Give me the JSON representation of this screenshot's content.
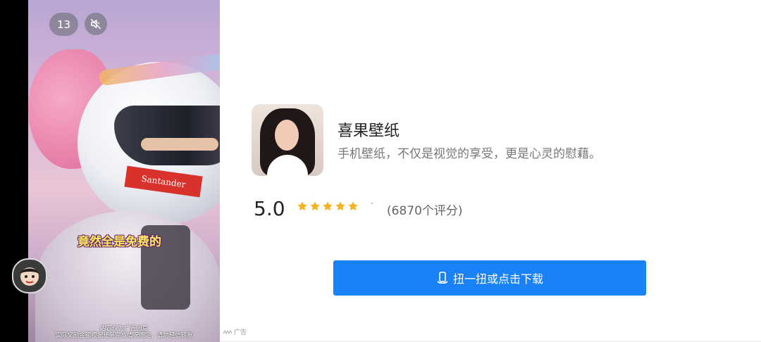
{
  "video": {
    "countdown": "13",
    "caption": "竟然全是免费的",
    "helmet_logo": "Santander",
    "disclaimer_line1": "内容仅为广告创意",
    "disclaimer_line2": "实际奖励金额根据任务完成情况而定，请勿轻信转账"
  },
  "ad": {
    "tag": "广告"
  },
  "app": {
    "name": "喜果壁纸",
    "description": "手机壁纸，不仅是视觉的享受，更是心灵的慰藉。",
    "rating": "5.0",
    "stars": 5,
    "rating_count": "(6870个评分)"
  },
  "download": {
    "label": "扭一扭或点击下载"
  },
  "colors": {
    "button": "#1a82f7",
    "star": "#f7b21b"
  },
  "icons": {
    "mute": "speaker-muted-icon",
    "phone": "phone-shake-icon"
  }
}
